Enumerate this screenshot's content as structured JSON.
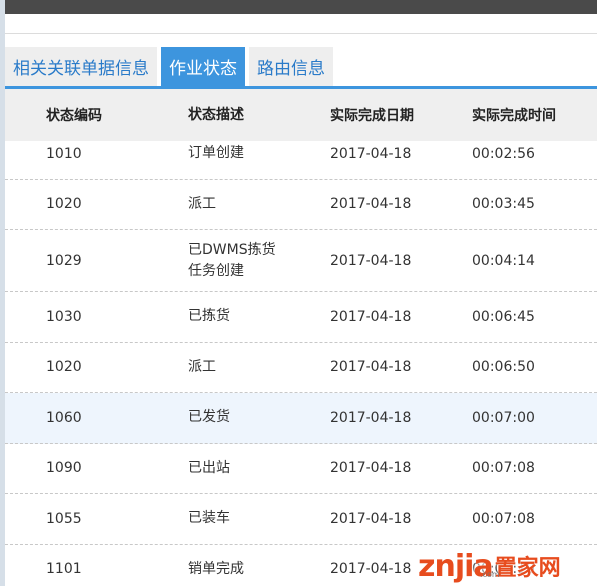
{
  "tabs": [
    {
      "label": "相关关联单据信息",
      "active": false
    },
    {
      "label": "作业状态",
      "active": true
    },
    {
      "label": "路由信息",
      "active": false
    }
  ],
  "table": {
    "headers": [
      "状态编码",
      "状态描述",
      "实际完成日期",
      "实际完成时间"
    ],
    "rows": [
      {
        "code": "1010",
        "desc": "订单创建",
        "date": "2017-04-18",
        "time": "00:02:56"
      },
      {
        "code": "1020",
        "desc": "派工",
        "date": "2017-04-18",
        "time": "00:03:45"
      },
      {
        "code": "1029",
        "desc": "已DWMS拣货任务创建",
        "date": "2017-04-18",
        "time": "00:04:14"
      },
      {
        "code": "1030",
        "desc": "已拣货",
        "date": "2017-04-18",
        "time": "00:06:45"
      },
      {
        "code": "1020",
        "desc": "派工",
        "date": "2017-04-18",
        "time": "00:06:50"
      },
      {
        "code": "1060",
        "desc": "已发货",
        "date": "2017-04-18",
        "time": "00:07:00"
      },
      {
        "code": "1090",
        "desc": "已出站",
        "date": "2017-04-18",
        "time": "00:07:08"
      },
      {
        "code": "1055",
        "desc": "已装车",
        "date": "2017-04-18",
        "time": "00:07:08"
      },
      {
        "code": "1101",
        "desc": "销单完成",
        "date": "2017-04-18",
        "time": "00:07:10"
      }
    ]
  },
  "watermark": {
    "logo": "znjia",
    "text": "置家网",
    "sub": ".com"
  },
  "colors": {
    "accent": "#3d95de",
    "tab_text": "#2a7bc9",
    "highlight_row": "#eef5fd"
  }
}
